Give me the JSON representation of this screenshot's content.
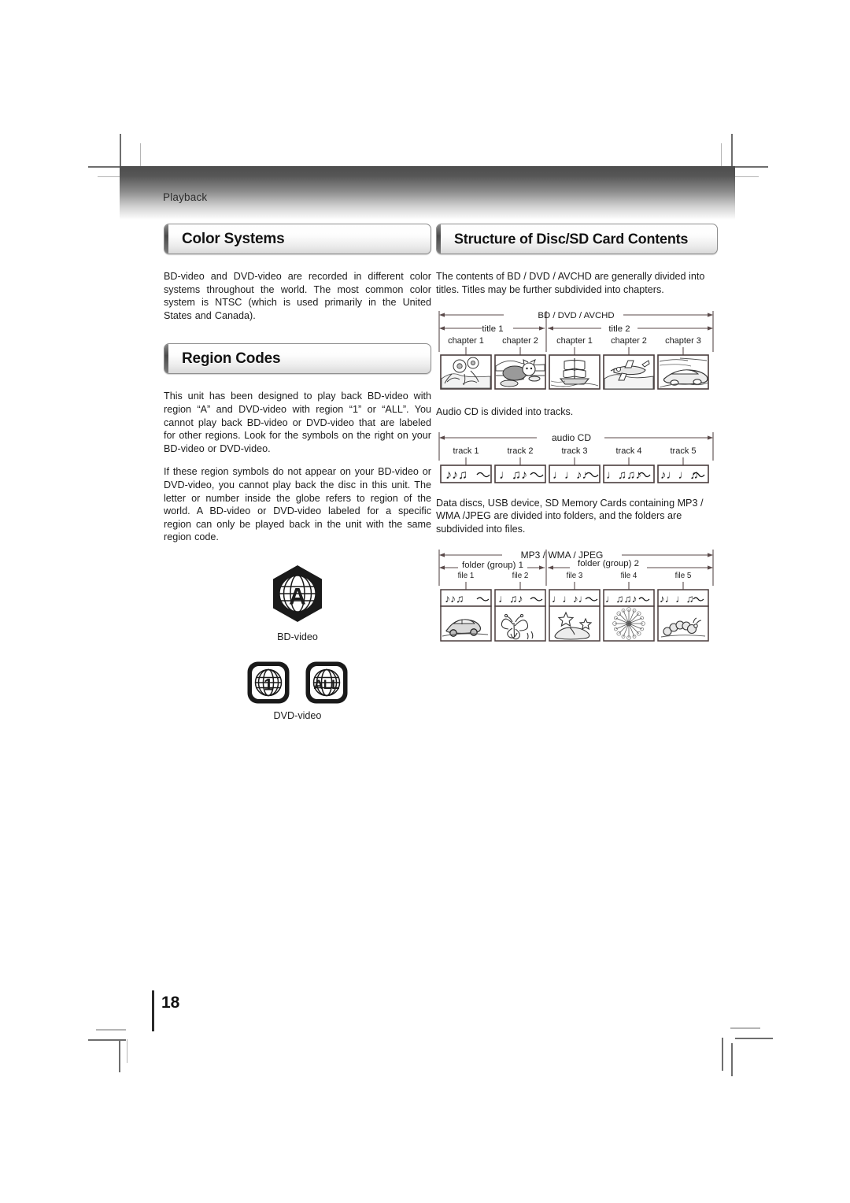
{
  "page": {
    "breadcrumb": "Playback",
    "number": "18"
  },
  "left_column": {
    "sections": [
      {
        "heading": "Color Systems",
        "paragraphs": [
          "BD-video and DVD-video are recorded in different color systems throughout the world. The most common color system is NTSC (which is used primarily in the United States and Canada)."
        ]
      },
      {
        "heading": "Region Codes",
        "paragraphs": [
          "This unit has been designed to play back BD-video with region “A” and DVD-video with region “1” or “ALL”. You cannot play back BD-video or DVD-video that are labeled for other regions. Look for the symbols on the right on your BD-video or DVD-video.",
          "If these region symbols do not appear on  your BD-video or DVD-video, you cannot play back the disc in this unit. The letter or number inside the globe refers to region of the world. A BD-video or DVD-video labeled for a specific region can only be played back in the unit with the same region code."
        ]
      }
    ],
    "region_symbols": {
      "bd": {
        "code": "A",
        "caption": "BD-video"
      },
      "dvd": {
        "codes": [
          "1",
          "ALL"
        ],
        "caption": "DVD-video"
      }
    }
  },
  "right_column": {
    "heading": "Structure of Disc/SD Card Contents",
    "intro": "The contents of BD / DVD / AVCHD are generally divided into titles. Titles may be further subdivided into chapters.",
    "diagram_bd": {
      "span_label": "BD / DVD / AVCHD",
      "groups": [
        {
          "label": "title 1",
          "cells": [
            "chapter 1",
            "chapter 2"
          ]
        },
        {
          "label": "title 2",
          "cells": [
            "chapter 1",
            "chapter 2",
            "chapter 3"
          ]
        }
      ],
      "thumbnails": [
        "flowers-thumb",
        "cat-thumb",
        "sailing-ship-thumb",
        "airplane-thumb",
        "car-thumb"
      ]
    },
    "audio_cd_intro": "Audio CD is divided into tracks.",
    "diagram_cd": {
      "span_label": "audio CD",
      "cells": [
        "track 1",
        "track 2",
        "track 3",
        "track 4",
        "track 5"
      ]
    },
    "data_disc_intro": "Data discs, USB device, SD Memory Cards containing MP3 / WMA /JPEG are divided into folders, and the folders are subdivided into files.",
    "diagram_mp3": {
      "span_label": "MP3 / WMA / JPEG",
      "groups": [
        {
          "label": "folder (group) 1",
          "cells": [
            "file 1",
            "file 2"
          ]
        },
        {
          "label": "folder (group) 2",
          "cells": [
            "file 3",
            "file 4",
            "file 5"
          ]
        }
      ],
      "thumbnails": [
        "car-thumb",
        "butterfly-thumb",
        "stars-thumb",
        "fireworks-thumb",
        "caterpillar-thumb"
      ]
    }
  },
  "colors": {
    "band_top": "#4d4d4d",
    "band_bottom": "#ffffff",
    "ink": "#1c1c1c",
    "rule": "#5a4a4a"
  }
}
